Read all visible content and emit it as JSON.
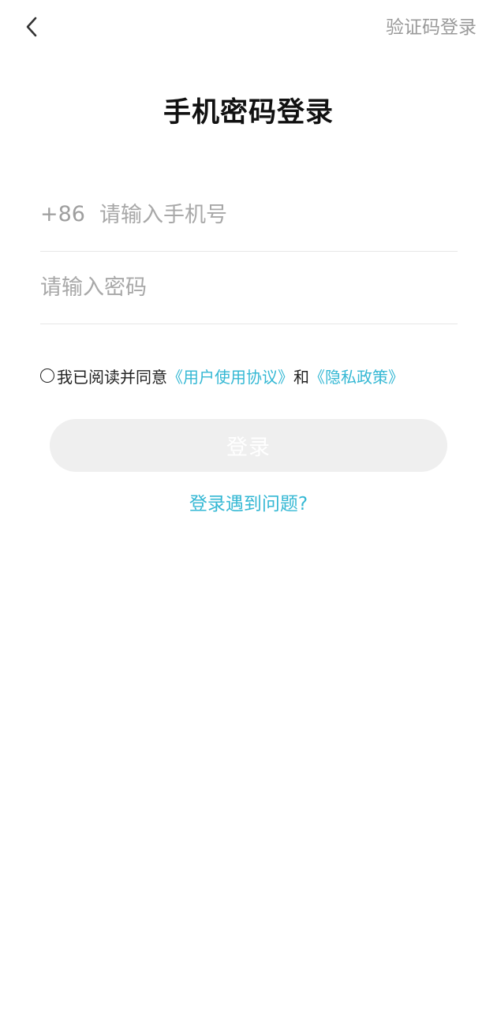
{
  "header": {
    "back_icon": "chevron-left-icon",
    "switch_login_label": "验证码登录"
  },
  "title": "手机密码登录",
  "phone_field": {
    "country_code": "+86",
    "placeholder": "请输入手机号",
    "value": ""
  },
  "password_field": {
    "placeholder": "请输入密码",
    "value": ""
  },
  "agreement": {
    "checked": false,
    "prefix": "我已阅读并同意",
    "user_agreement": "《用户使用协议》",
    "conjunction": "和",
    "privacy_policy": "《隐私政策》"
  },
  "login_button_label": "登录",
  "help_link": "登录遇到问题?",
  "colors": {
    "link": "#35b8d4",
    "button_disabled_bg": "#efefef",
    "muted_text": "#9a9a9a"
  }
}
